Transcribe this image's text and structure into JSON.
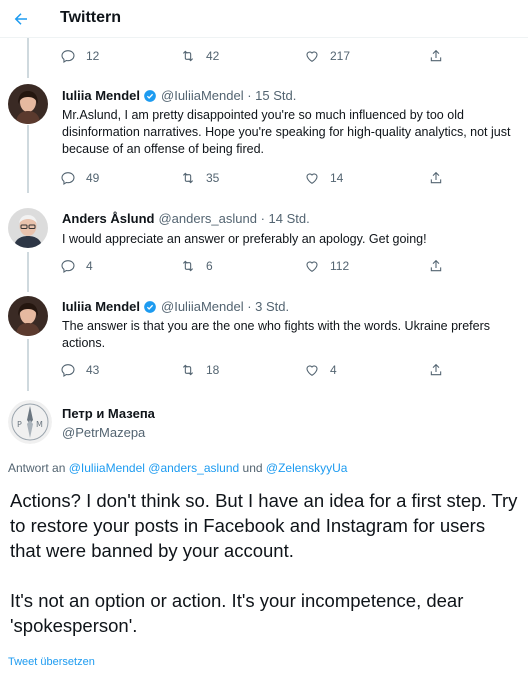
{
  "header": {
    "title": "Twittern"
  },
  "top_actions": {
    "replies": "12",
    "retweets": "42",
    "likes": "217"
  },
  "tweets": [
    {
      "name": "Iuliia Mendel",
      "handle": "@IuliiaMendel · 15 Std.",
      "verified": true,
      "text": "Mr.Aslund, I am pretty disappointed you're so much influenced by too old disinformation narratives. Hope you're speaking for high-quality analytics, not just because of an offense of being fired.",
      "replies": "49",
      "retweets": "35",
      "likes": "14"
    },
    {
      "name": "Anders Åslund",
      "handle": "@anders_aslund · 14 Std.",
      "verified": false,
      "text": "I would appreciate an answer or preferably an apology. Get going!",
      "replies": "4",
      "retweets": "6",
      "likes": "112"
    },
    {
      "name": "Iuliia Mendel",
      "handle": "@IuliiaMendel · 3 Std.",
      "verified": true,
      "text": "The answer is that you are the one who fights with the words. Ukraine prefers actions.",
      "replies": "43",
      "retweets": "18",
      "likes": "4"
    }
  ],
  "main_tweet": {
    "name": "Петр и Мазепа",
    "handle": "@PetrMazepa",
    "reply_prefix": "Antwort an",
    "reply_user1": "@IuliiaMendel",
    "reply_user2": "@anders_aslund",
    "reply_und": "und",
    "reply_user3": "@ZelenskyyUa",
    "paragraph1": "Actions? I don't think so. But I have an idea for a first step. Try to restore your posts in Facebook and Instagram for users that were banned by your account.",
    "paragraph2": "It's not an option or action. It's your incompetence, dear 'spokesperson'.",
    "translate": "Tweet übersetzen"
  },
  "colors": {
    "accent": "#1d9bf0",
    "secondary_text": "#536471",
    "thread_line": "#cfd9de"
  },
  "icons": [
    "back-arrow-icon",
    "reply-icon",
    "retweet-icon",
    "like-icon",
    "share-icon",
    "verified-badge-icon"
  ]
}
